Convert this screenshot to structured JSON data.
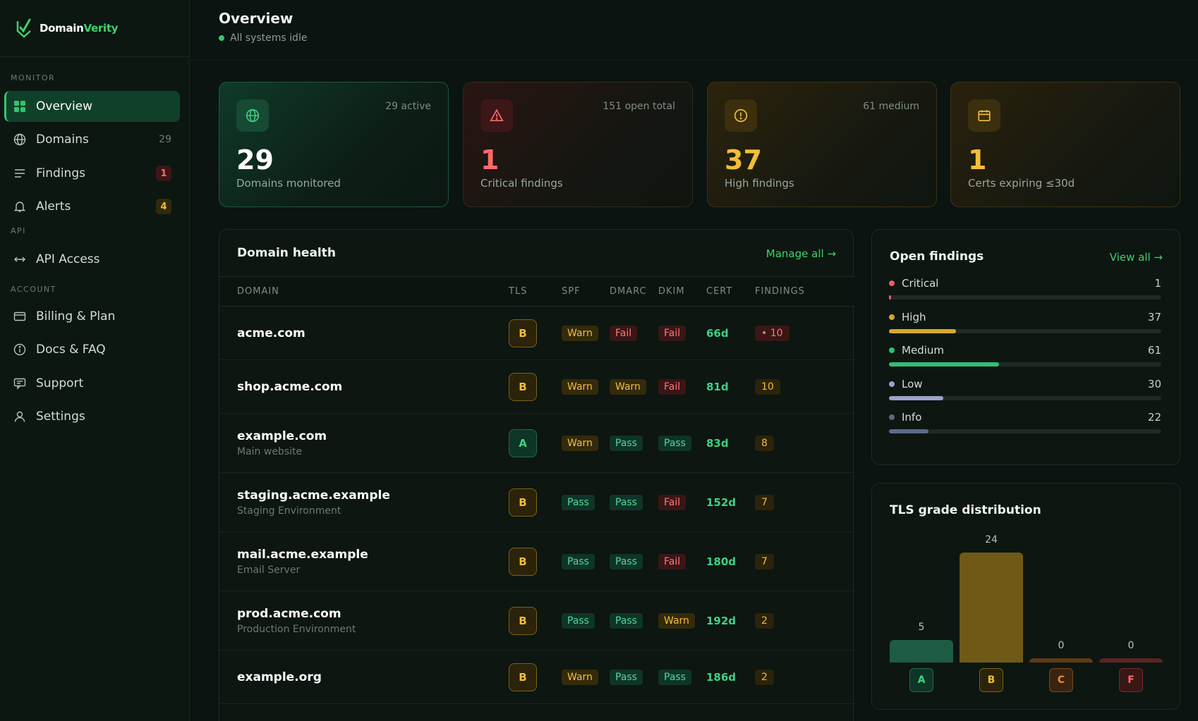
{
  "brand": {
    "name_part1": "Domain",
    "name_part2": "Verity"
  },
  "sidebar": {
    "sections": {
      "monitor": "MONITOR",
      "api": "API",
      "account": "ACCOUNT"
    },
    "items": [
      {
        "label": "Overview"
      },
      {
        "label": "Domains",
        "count": "29"
      },
      {
        "label": "Findings",
        "badge": "1"
      },
      {
        "label": "Alerts",
        "badge": "4"
      },
      {
        "label": "API Access"
      },
      {
        "label": "Billing & Plan"
      },
      {
        "label": "Docs & FAQ"
      },
      {
        "label": "Support"
      },
      {
        "label": "Settings"
      }
    ]
  },
  "header": {
    "title": "Overview",
    "status": "All systems idle"
  },
  "stats": [
    {
      "value": "29",
      "label": "Domains monitored",
      "meta": "29 active"
    },
    {
      "value": "1",
      "label": "Critical findings",
      "meta": "151 open total"
    },
    {
      "value": "37",
      "label": "High findings",
      "meta": "61 medium"
    },
    {
      "value": "1",
      "label": "Certs expiring ≤30d",
      "meta": ""
    }
  ],
  "domain_health": {
    "title": "Domain health",
    "link": "Manage all →",
    "columns": [
      "DOMAIN",
      "TLS",
      "SPF",
      "DMARC",
      "DKIM",
      "CERT",
      "FINDINGS"
    ],
    "rows": [
      {
        "domain": "acme.com",
        "sub": "",
        "tls": "B",
        "spf": "Warn",
        "dmarc": "Fail",
        "dkim": "Fail",
        "cert": "66d",
        "findings": "• 10",
        "critical": true
      },
      {
        "domain": "shop.acme.com",
        "sub": "",
        "tls": "B",
        "spf": "Warn",
        "dmarc": "Warn",
        "dkim": "Fail",
        "cert": "81d",
        "findings": "10",
        "critical": false
      },
      {
        "domain": "example.com",
        "sub": "Main website",
        "tls": "A",
        "spf": "Warn",
        "dmarc": "Pass",
        "dkim": "Pass",
        "cert": "83d",
        "findings": "8",
        "critical": false
      },
      {
        "domain": "staging.acme.example",
        "sub": "Staging Environment",
        "tls": "B",
        "spf": "Pass",
        "dmarc": "Pass",
        "dkim": "Fail",
        "cert": "152d",
        "findings": "7",
        "critical": false
      },
      {
        "domain": "mail.acme.example",
        "sub": "Email Server",
        "tls": "B",
        "spf": "Pass",
        "dmarc": "Pass",
        "dkim": "Fail",
        "cert": "180d",
        "findings": "7",
        "critical": false
      },
      {
        "domain": "prod.acme.com",
        "sub": "Production Environment",
        "tls": "B",
        "spf": "Pass",
        "dmarc": "Pass",
        "dkim": "Warn",
        "cert": "192d",
        "findings": "2",
        "critical": false
      },
      {
        "domain": "example.org",
        "sub": "",
        "tls": "B",
        "spf": "Warn",
        "dmarc": "Pass",
        "dkim": "Pass",
        "cert": "186d",
        "findings": "2",
        "critical": false
      }
    ]
  },
  "open_findings": {
    "title": "Open findings",
    "link": "View all →",
    "total": 151,
    "items": [
      {
        "label": "Critical",
        "count": "1",
        "value": 1,
        "color": "#f25c5c"
      },
      {
        "label": "High",
        "count": "37",
        "value": 37,
        "color": "#d8a82a"
      },
      {
        "label": "Medium",
        "count": "61",
        "value": 61,
        "color": "#2fbf7a"
      },
      {
        "label": "Low",
        "count": "30",
        "value": 30,
        "color": "#9aa3c8"
      },
      {
        "label": "Info",
        "count": "22",
        "value": 22,
        "color": "#5d6a86"
      }
    ]
  },
  "tls_chart": {
    "title": "TLS grade distribution",
    "chart_data": {
      "type": "bar",
      "categories": [
        "A",
        "B",
        "C",
        "F"
      ],
      "values": [
        5,
        24,
        0,
        0
      ],
      "value_labels": [
        "5",
        "24",
        "0",
        "0"
      ],
      "colors": [
        "#1d5c42",
        "#6e5a16",
        "#5e3a17",
        "#5a2424"
      ]
    }
  }
}
